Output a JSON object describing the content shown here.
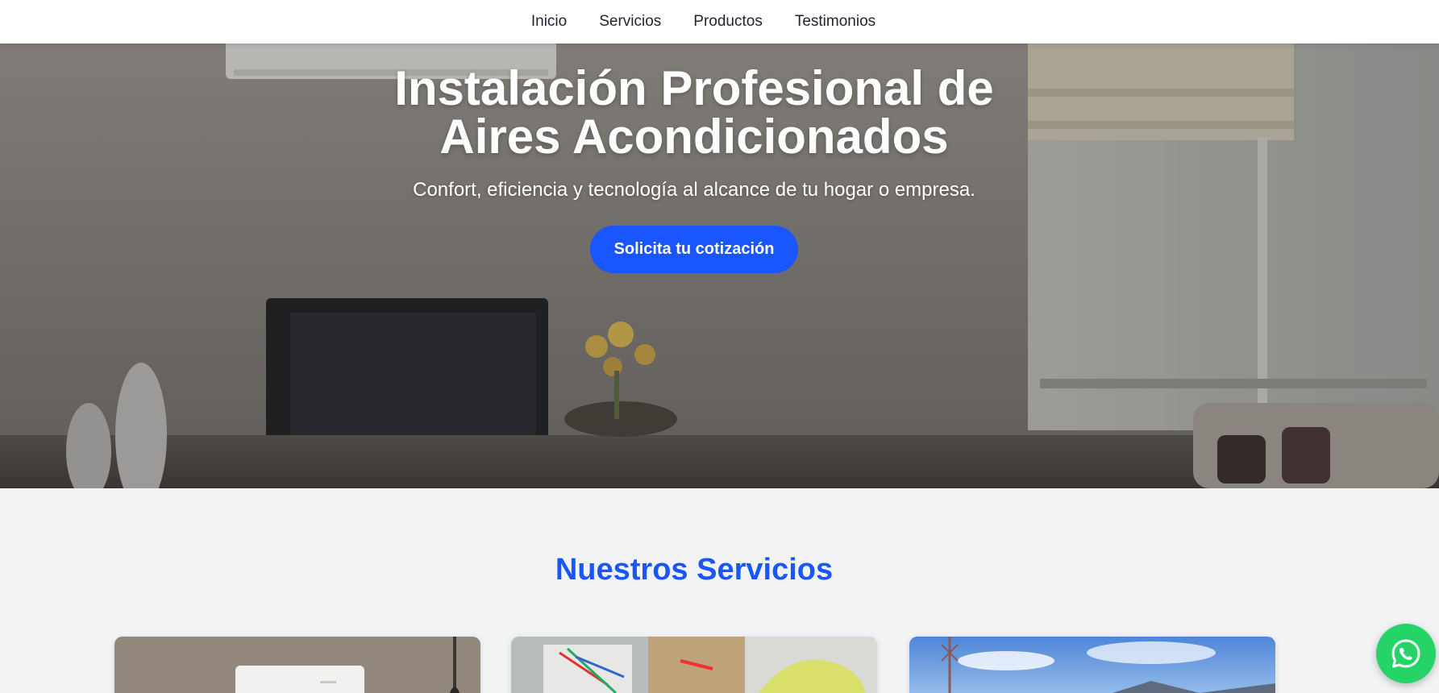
{
  "nav": {
    "items": [
      {
        "label": "Inicio"
      },
      {
        "label": "Servicios"
      },
      {
        "label": "Productos"
      },
      {
        "label": "Testimonios"
      }
    ]
  },
  "hero": {
    "title_line1": "Instalación Profesional de",
    "title_line2": "Aires Acondicionados",
    "subtitle": "Confort, eficiencia y tecnología al alcance de tu hogar o empresa.",
    "cta_label": "Solicita tu cotización"
  },
  "services": {
    "title": "Nuestros Servicios",
    "cards": [
      {
        "image": "wall-air-conditioner-image"
      },
      {
        "image": "electrician-wiring-image"
      },
      {
        "image": "outdoor-landscape-image"
      }
    ]
  },
  "floating": {
    "whatsapp_icon": "whatsapp-icon"
  },
  "colors": {
    "accent": "#1a56ff",
    "whatsapp": "#25d366",
    "nav_bg": "#ffffff",
    "page_bg": "#f2f3f5"
  }
}
